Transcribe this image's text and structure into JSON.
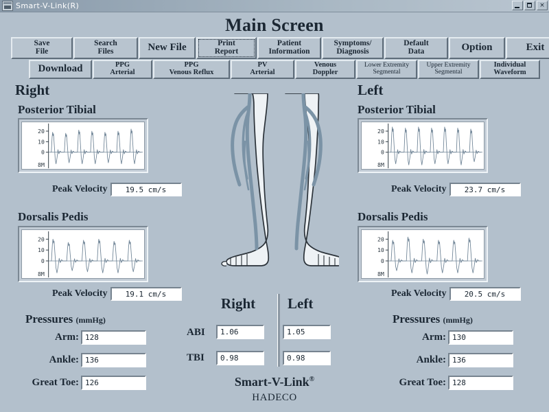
{
  "window": {
    "title": "Smart-V-Link(R)",
    "icon": "app-icon",
    "minimize": "_",
    "maximize": "□",
    "close": "×"
  },
  "header": {
    "title": "Main Screen"
  },
  "toolbar_main": [
    {
      "line1": "Save",
      "line2": "File",
      "style": "two",
      "focused": false
    },
    {
      "line1": "Search",
      "line2": "Files",
      "style": "two",
      "focused": false
    },
    {
      "line1": "New File",
      "line2": "",
      "style": "big",
      "focused": false
    },
    {
      "line1": "Print",
      "line2": "Report",
      "style": "two",
      "focused": true
    },
    {
      "line1": "Patient",
      "line2": "Information",
      "style": "two",
      "focused": false
    },
    {
      "line1": "Symptoms/",
      "line2": "Diagnosis",
      "style": "two",
      "focused": false
    },
    {
      "line1": "Default",
      "line2": "Data",
      "style": "two",
      "focused": false
    },
    {
      "line1": "Option",
      "line2": "",
      "style": "big",
      "focused": false
    },
    {
      "line1": "Exit",
      "line2": "",
      "style": "big",
      "focused": false
    }
  ],
  "toolbar_sub": [
    {
      "line1": "Download",
      "line2": "",
      "style": "big"
    },
    {
      "line1": "PPG",
      "line2": "Arterial",
      "style": "two"
    },
    {
      "line1": "PPG",
      "line2": "Venous Reflux",
      "style": "two"
    },
    {
      "line1": "PV",
      "line2": "Arterial",
      "style": "two"
    },
    {
      "line1": "Venous",
      "line2": "Doppler",
      "style": "two"
    },
    {
      "line1": "Lower Extremity",
      "line2": "Segmental",
      "style": "small"
    },
    {
      "line1": "Upper Extremity",
      "line2": "Segmental",
      "style": "small"
    },
    {
      "line1": "Individual",
      "line2": "Waveform",
      "style": "two"
    }
  ],
  "sides": {
    "right_label": "Right",
    "left_label": "Left"
  },
  "waveforms": {
    "peak_velocity_label": "Peak Velocity",
    "right_posterior_tibial": {
      "title": "Posterior Tibial",
      "peak_velocity": "19.5 cm/s"
    },
    "left_posterior_tibial": {
      "title": "Posterior Tibial",
      "peak_velocity": "23.7 cm/s"
    },
    "right_dorsalis_pedis": {
      "title": "Dorsalis Pedis",
      "peak_velocity": "19.1 cm/s"
    },
    "left_dorsalis_pedis": {
      "title": "Dorsalis Pedis",
      "peak_velocity": "20.5 cm/s"
    }
  },
  "chart_data": [
    {
      "id": "right_posterior_tibial",
      "type": "line",
      "title": "Posterior Tibial",
      "ylabel": "",
      "xlabel": "",
      "yticks": [
        20,
        10,
        0
      ],
      "ytick_labels": [
        "20",
        "10",
        "0"
      ],
      "scale_label": "8M",
      "ylim": [
        -14,
        26
      ],
      "grid": false,
      "beats": 7,
      "peak_values": [
        19,
        18,
        21,
        20,
        19,
        20,
        22
      ],
      "trough_values": [
        -11,
        -10,
        -11,
        -11,
        -10,
        -11,
        -11
      ]
    },
    {
      "id": "left_posterior_tibial",
      "type": "line",
      "title": "Posterior Tibial",
      "ylabel": "",
      "xlabel": "",
      "yticks": [
        20,
        10,
        0
      ],
      "ytick_labels": [
        "20",
        "10",
        "0"
      ],
      "scale_label": "8M",
      "ylim": [
        -14,
        26
      ],
      "grid": false,
      "beats": 7,
      "peak_values": [
        24,
        23,
        24,
        23,
        24,
        23,
        22
      ],
      "trough_values": [
        -11,
        -12,
        -12,
        -11,
        -11,
        -12,
        -9
      ]
    },
    {
      "id": "right_dorsalis_pedis",
      "type": "line",
      "title": "Dorsalis Pedis",
      "ylabel": "",
      "xlabel": "",
      "yticks": [
        20,
        10,
        0
      ],
      "ytick_labels": [
        "20",
        "10",
        "0"
      ],
      "scale_label": "8M",
      "ylim": [
        -14,
        26
      ],
      "grid": false,
      "beats": 6,
      "peak_values": [
        20,
        17,
        19,
        20,
        18,
        19
      ],
      "trough_values": [
        -11,
        -9,
        -10,
        -11,
        -11,
        -10
      ]
    },
    {
      "id": "left_dorsalis_pedis",
      "type": "line",
      "title": "Dorsalis Pedis",
      "ylabel": "",
      "xlabel": "",
      "yticks": [
        20,
        10,
        0
      ],
      "ytick_labels": [
        "20",
        "10",
        "0"
      ],
      "scale_label": "8M",
      "ylim": [
        -14,
        26
      ],
      "grid": false,
      "beats": 6,
      "peak_values": [
        19,
        22,
        20,
        19,
        19,
        21
      ],
      "trough_values": [
        -9,
        -11,
        -12,
        -11,
        -11,
        -11
      ]
    }
  ],
  "indices": {
    "right_head": "Right",
    "left_head": "Left",
    "rows": [
      {
        "label": "ABI",
        "right": "1.06",
        "left": "1.05"
      },
      {
        "label": "TBI",
        "right": "0.98",
        "left": "0.98"
      }
    ]
  },
  "pressures": {
    "title": "Pressures",
    "unit": "(mmHg)",
    "right": [
      {
        "label": "Arm:",
        "value": "128"
      },
      {
        "label": "Ankle:",
        "value": "136"
      },
      {
        "label": "Great Toe:",
        "value": "126"
      }
    ],
    "left": [
      {
        "label": "Arm:",
        "value": "130"
      },
      {
        "label": "Ankle:",
        "value": "136"
      },
      {
        "label": "Great Toe:",
        "value": "128"
      }
    ]
  },
  "footer": {
    "brand": "Smart-V-Link",
    "registered": "®",
    "company": "HADECO"
  },
  "colors": {
    "background": "#b3c0cc",
    "button_face": "#b8c4cf",
    "field_bg": "#ffffff",
    "text": "#1b2733",
    "waveform": "#6f8496",
    "vessel": "#7b93a6"
  }
}
